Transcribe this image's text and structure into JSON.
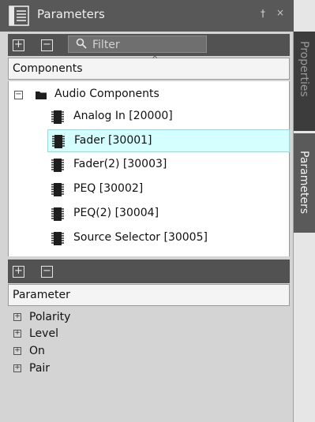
{
  "window": {
    "title": "Parameters",
    "pin_glyph": "†",
    "close_glyph": "×"
  },
  "components_toolbar": {
    "expand_glyph": "+",
    "collapse_glyph": "−",
    "filter_placeholder": "Filter"
  },
  "components": {
    "header": "Components",
    "sort_glyph": "^",
    "root": {
      "label": "Audio Components",
      "expander_glyph": "−",
      "icon": "folder-icon"
    },
    "items": [
      {
        "label": "Analog In [20000]",
        "icon": "component-chip-icon",
        "selected": false
      },
      {
        "label": "Fader [30001]",
        "icon": "component-chip-icon",
        "selected": true
      },
      {
        "label": "Fader(2) [30003]",
        "icon": "component-chip-icon",
        "selected": false
      },
      {
        "label": "PEQ [30002]",
        "icon": "component-chip-icon",
        "selected": false
      },
      {
        "label": "PEQ(2) [30004]",
        "icon": "component-chip-icon",
        "selected": false
      },
      {
        "label": "Source Selector [30005]",
        "icon": "component-chip-icon",
        "selected": false
      }
    ]
  },
  "parameters_toolbar": {
    "expand_glyph": "+",
    "collapse_glyph": "−"
  },
  "parameters": {
    "header": "Parameter",
    "expander_glyph": "+",
    "items": [
      {
        "label": "Polarity"
      },
      {
        "label": "Level"
      },
      {
        "label": "On"
      },
      {
        "label": "Pair"
      }
    ]
  },
  "side_tabs": {
    "properties": "Properties",
    "parameters": "Parameters"
  },
  "colors": {
    "selection_bg": "#d5ffff",
    "title_bar": "#585858",
    "toolbar": "#525252"
  }
}
